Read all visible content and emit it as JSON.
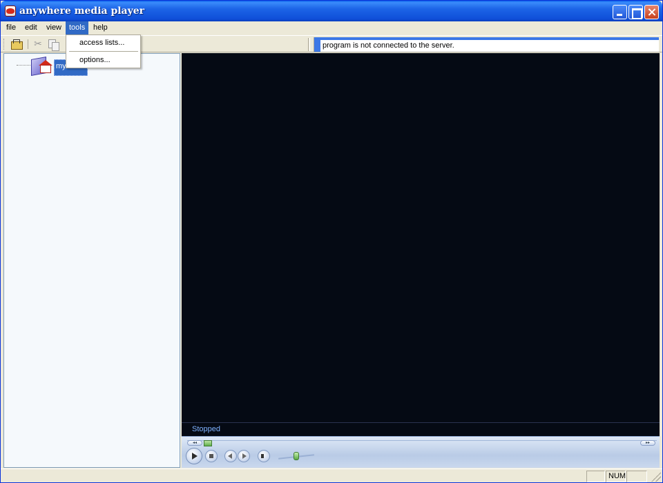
{
  "window": {
    "title": "anywhere media player"
  },
  "menubar": {
    "items": [
      {
        "label": "file"
      },
      {
        "label": "edit"
      },
      {
        "label": "view"
      },
      {
        "label": "tools",
        "active": true
      },
      {
        "label": "help"
      }
    ]
  },
  "tools_menu": {
    "items": [
      {
        "label": "access lists..."
      },
      {
        "label": "options..."
      }
    ]
  },
  "toolbar": {
    "icons": [
      "open-folder-icon",
      "cut-icon",
      "copy-icon"
    ],
    "server_status": "program is not connected to the server."
  },
  "tree": {
    "root_label": "my",
    "root_icon": "home-folder-icon"
  },
  "player": {
    "status": "Stopped",
    "controls": [
      "play-icon",
      "stop-icon",
      "previous-icon",
      "next-icon",
      "mute-icon",
      "volume-slider"
    ],
    "seek_position": 0.0
  },
  "statusbar": {
    "num_indicator": "NUM"
  },
  "colors": {
    "titlebar": "#0F4FD8",
    "selection": "#316AC5",
    "video_bg": "#050A14",
    "status_text": "#7FB2FF"
  }
}
